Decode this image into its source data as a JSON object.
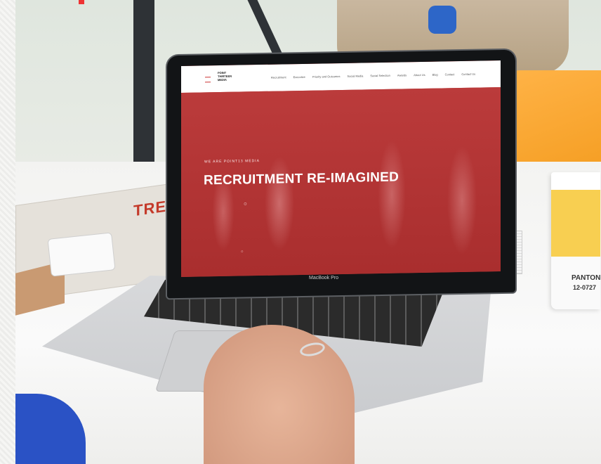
{
  "site": {
    "logo_lines": [
      "POINT",
      "THIRTEEN",
      "MEDIA"
    ],
    "nav_items": [
      "Recruitment",
      "Executive",
      "Priority and Outcomes",
      "Social Media",
      "Social Selection",
      "Awards",
      "About Us",
      "Blog",
      "Contact",
      "Contact Us"
    ],
    "hero_kicker": "WE ARE POINT13 MEDIA",
    "hero_title": "RECRUITMENT RE-IMAGINED"
  },
  "device": {
    "bezel_label": "MacBook Pro"
  },
  "desk_items": {
    "magazine_text": "TREL",
    "mug_brand": "PANTONE",
    "mug_code": "12-0727"
  },
  "colors": {
    "hero_red": "#b73838",
    "mug_yellow": "#f8cf51",
    "pillow_orange": "#f39a1c"
  }
}
